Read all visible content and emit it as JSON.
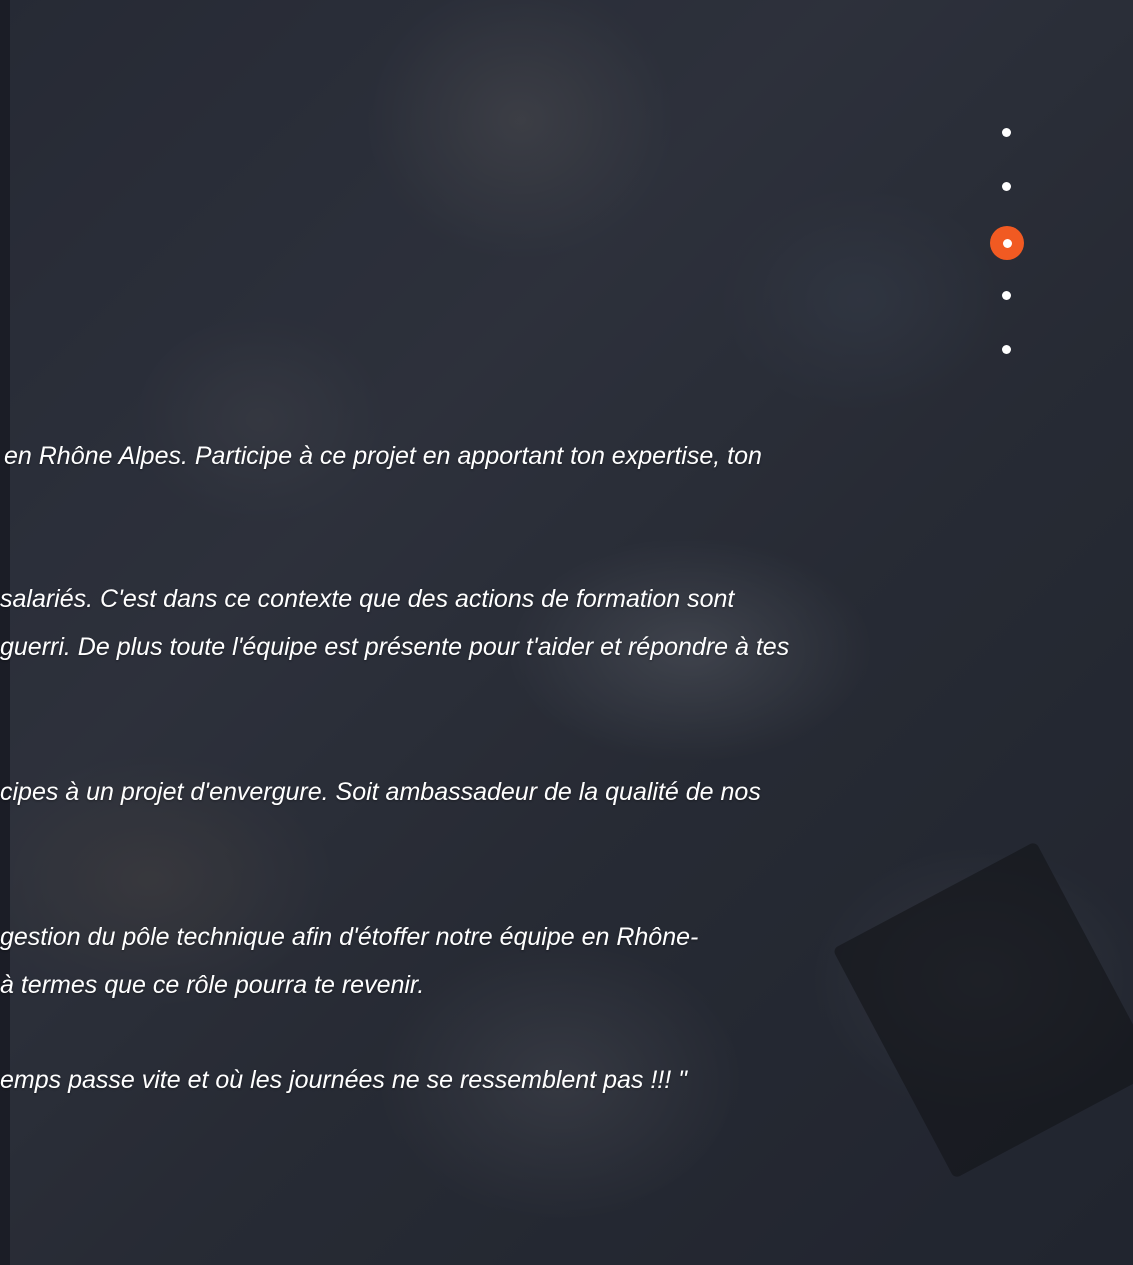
{
  "colors": {
    "accent": "#f15a22",
    "text": "#ffffff",
    "overlay": "#1b1d26"
  },
  "slider": {
    "dot_count": 5,
    "active_index": 2
  },
  "text_lines": [
    "en Rhône Alpes. Participe à ce projet en apportant ton expertise,  ton",
    "salariés. C'est dans ce contexte que des actions de formation sont",
    "guerri. De plus toute l'équipe est présente pour t'aider et répondre  à tes",
    "cipes à un projet d'envergure. Soit ambassadeur de la qualité de  nos",
    "gestion du pôle technique afin d'étoffer notre équipe en Rhône-",
    "à termes que ce rôle pourra te revenir.",
    "emps passe vite et où les journées ne se ressemblent pas !!! \""
  ]
}
